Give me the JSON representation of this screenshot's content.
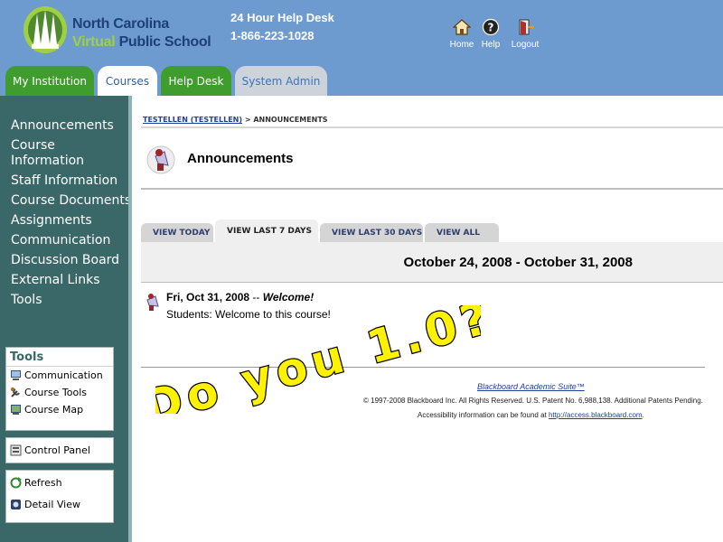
{
  "header": {
    "logo_line1": "North Carolina",
    "logo_line2_part1": "Virtual",
    "logo_line2_part2": "Public School",
    "help_desk_title": "24 Hour Help Desk",
    "help_desk_phone": "1-866-223-1028",
    "links": {
      "home": "Home",
      "help": "Help",
      "logout": "Logout"
    }
  },
  "tabs": {
    "my_institution": "My Institution",
    "courses": "Courses",
    "help_desk": "Help Desk",
    "system_admin": "System Admin"
  },
  "sidebar": {
    "items": [
      "Announcements",
      "Course",
      "Information",
      "Staff Information",
      "Course Documents",
      "Assignments",
      "Communication",
      "Discussion Board",
      "External Links",
      "Tools"
    ],
    "tools_panel": {
      "title": "Tools",
      "items": [
        "Communication",
        "Course Tools",
        "Course Map"
      ]
    },
    "control_panel": "Control Panel",
    "refresh": "Refresh",
    "detail_view": "Detail View"
  },
  "breadcrumb": {
    "course": "TESTELLEN (TESTELLEN)",
    "current": "> ANNOUNCEMENTS"
  },
  "page_title": "Announcements",
  "subtabs": {
    "today": "VIEW TODAY",
    "last7": "VIEW LAST 7 DAYS",
    "last30": "VIEW LAST 30 DAYS",
    "all": "VIEW ALL"
  },
  "date_range": "October 24, 2008 - October 31, 2008",
  "announcement": {
    "date": "Fri, Oct 31, 2008",
    "separator": "--",
    "title": "Welcome!",
    "body": "Students: Welcome to this course!"
  },
  "footer": {
    "suite_link": "Blackboard Academic Suite™",
    "copyright": "© 1997-2008 Blackboard Inc. All Rights Reserved. U.S. Patent No. 6,988,138. Additional Patents Pending.",
    "access_text": "Accessibility information can be found at",
    "access_link": "http://access.blackboard.com",
    "access_end": "."
  },
  "overlay_text": "Do you 1.0?",
  "colors": {
    "header_bg": "#6e9bcf",
    "tab_green": "#3f9d2d",
    "sidebar_bg": "#3a6768",
    "overlay_fill": "#fff200"
  }
}
